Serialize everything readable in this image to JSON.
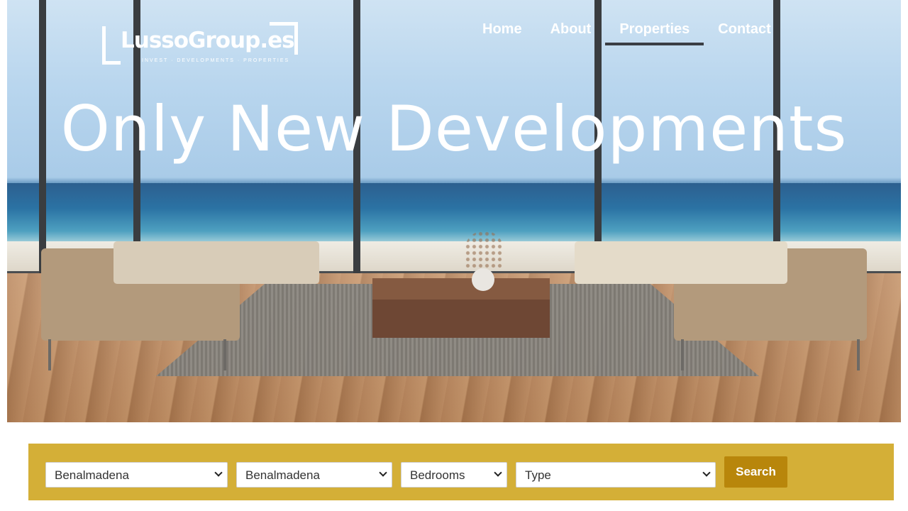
{
  "logo": {
    "brand": "LussoGroup.es",
    "tagline": "INVEST · DEVELOPMENTS · PROPERTIES"
  },
  "nav": {
    "items": [
      {
        "label": "Home"
      },
      {
        "label": "About"
      },
      {
        "label": "Properties"
      },
      {
        "label": "Contact"
      }
    ],
    "active": "Properties"
  },
  "hero": {
    "headline": "Only New Developments"
  },
  "search": {
    "location": "Benalmadena",
    "area": "Benalmadena",
    "bedrooms": "Bedrooms",
    "type": "Type",
    "button": "Search"
  },
  "colors": {
    "search_bar": "#d4af37",
    "search_button": "#b8860b",
    "active_underline": "#3a3e44"
  }
}
